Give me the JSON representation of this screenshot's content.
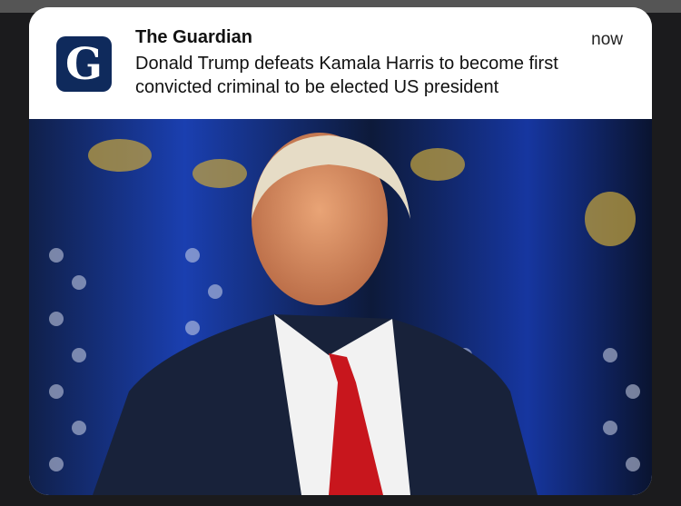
{
  "notification": {
    "app_name": "The Guardian",
    "time": "now",
    "message": "Donald Trump defeats Kamala Harris to become first convicted criminal to be elected US president",
    "app_icon": "guardian-g-logo",
    "logo_letter": "G",
    "brand_color": "#0f2a5c",
    "image": "photo-of-donald-trump-in-front-of-american-flags"
  }
}
